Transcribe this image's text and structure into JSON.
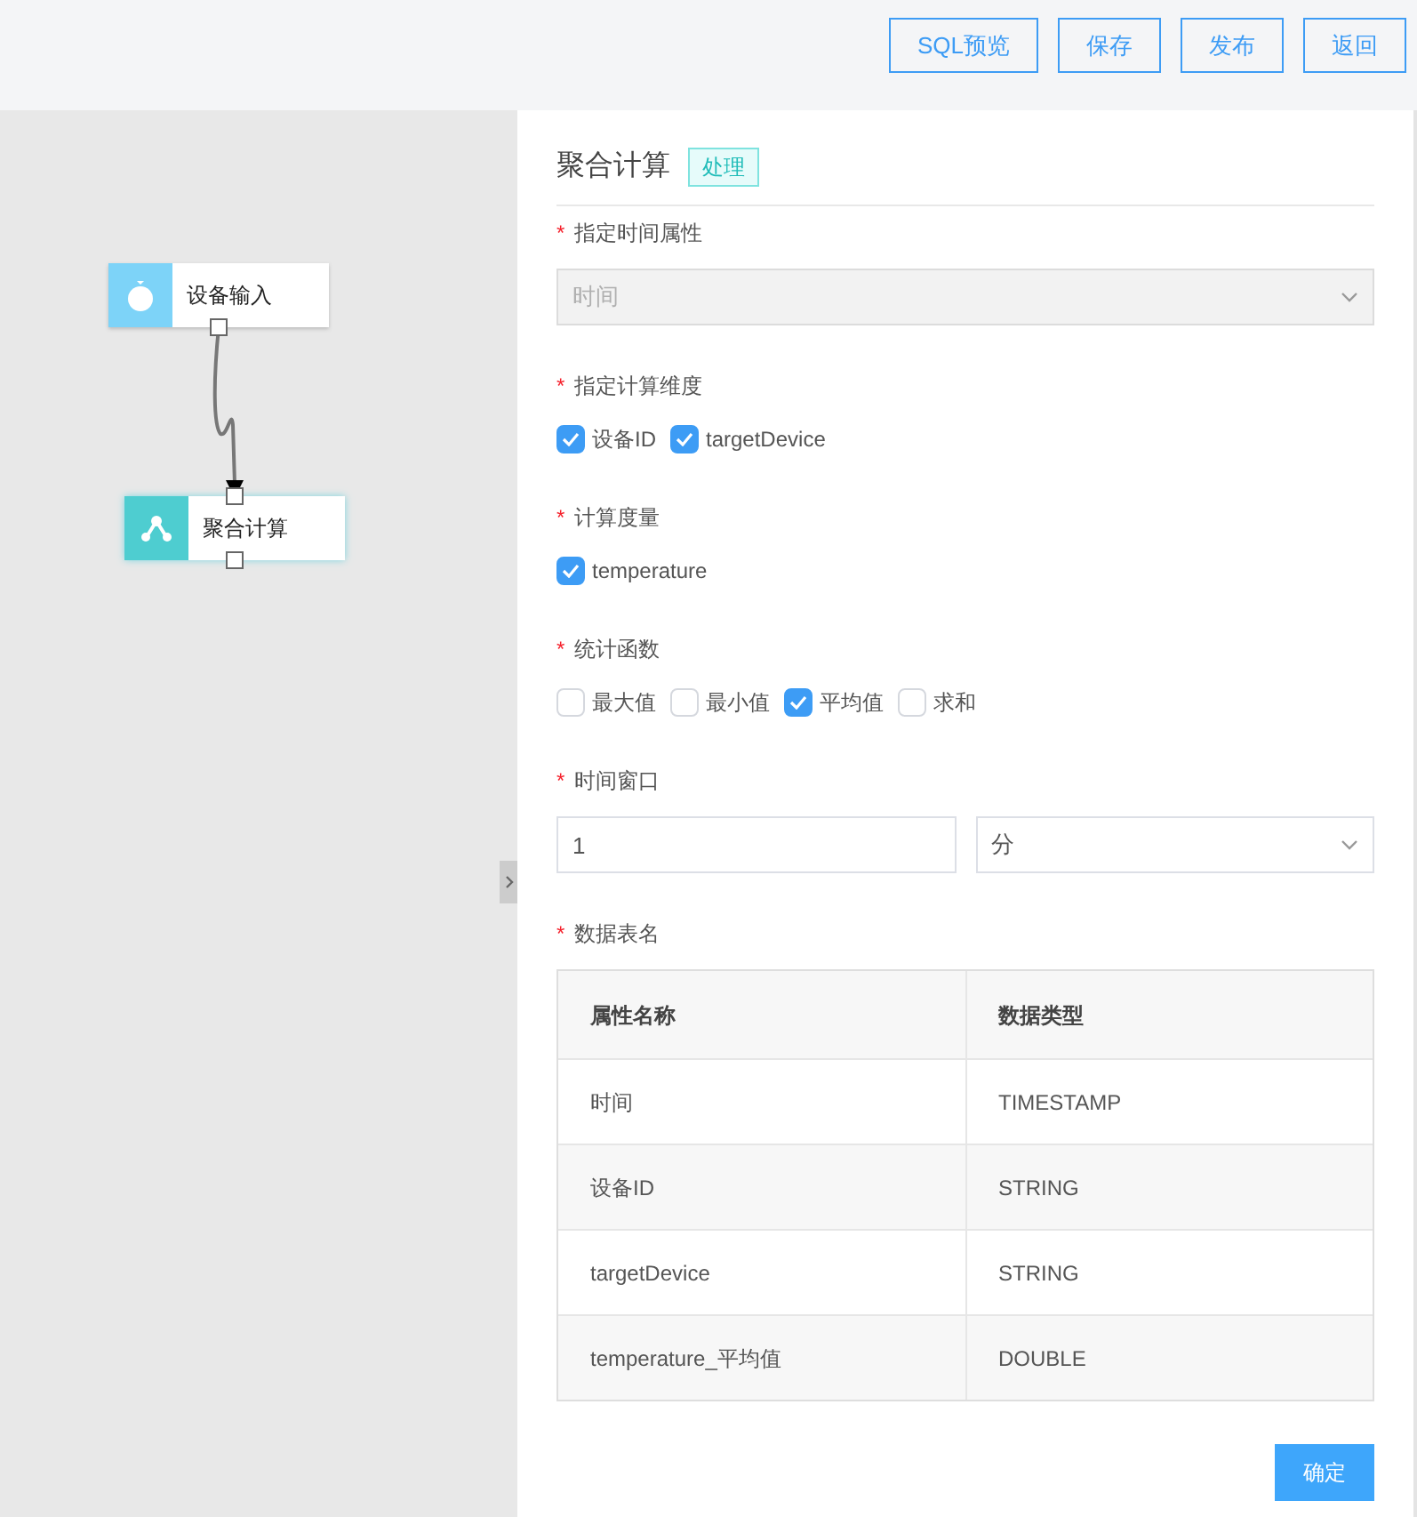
{
  "toolbar": {
    "buttons": [
      "SQL预览",
      "保存",
      "发布",
      "返回"
    ]
  },
  "canvas": {
    "nodes": [
      {
        "label": "设备输入",
        "kind": "input"
      },
      {
        "label": "聚合计算",
        "kind": "aggregate"
      }
    ]
  },
  "panel": {
    "title": "聚合计算",
    "tag": "处理",
    "fields": [
      {
        "kind": "select",
        "label": "指定时间属性",
        "marker": "*",
        "value": "时间",
        "disabled": true
      },
      {
        "kind": "checkboxes",
        "label": "指定计算维度",
        "marker": "*",
        "options": [
          {
            "label": "设备ID",
            "checked": true
          },
          {
            "label": "targetDevice",
            "checked": true
          }
        ]
      },
      {
        "kind": "checkboxes",
        "label": "计算度量",
        "marker": "*",
        "options": [
          {
            "label": "temperature",
            "checked": true
          }
        ]
      },
      {
        "kind": "checkboxes",
        "label": "统计函数",
        "marker": "*",
        "options": [
          {
            "label": "最大值",
            "checked": false
          },
          {
            "label": "最小值",
            "checked": false
          },
          {
            "label": "平均值",
            "checked": true
          },
          {
            "label": "求和",
            "checked": false
          }
        ]
      },
      {
        "kind": "window",
        "label": "时间窗口",
        "marker": "*",
        "value": "1",
        "unit": "分"
      },
      {
        "kind": "table",
        "label": "数据表名",
        "marker": "*",
        "columns": [
          "属性名称",
          "数据类型"
        ],
        "rows": [
          [
            "时间",
            "TIMESTAMP"
          ],
          [
            "设备ID",
            "STRING"
          ],
          [
            "targetDevice",
            "STRING"
          ],
          [
            "temperature_平均值",
            "DOUBLE"
          ]
        ]
      }
    ],
    "confirm": "确定"
  }
}
